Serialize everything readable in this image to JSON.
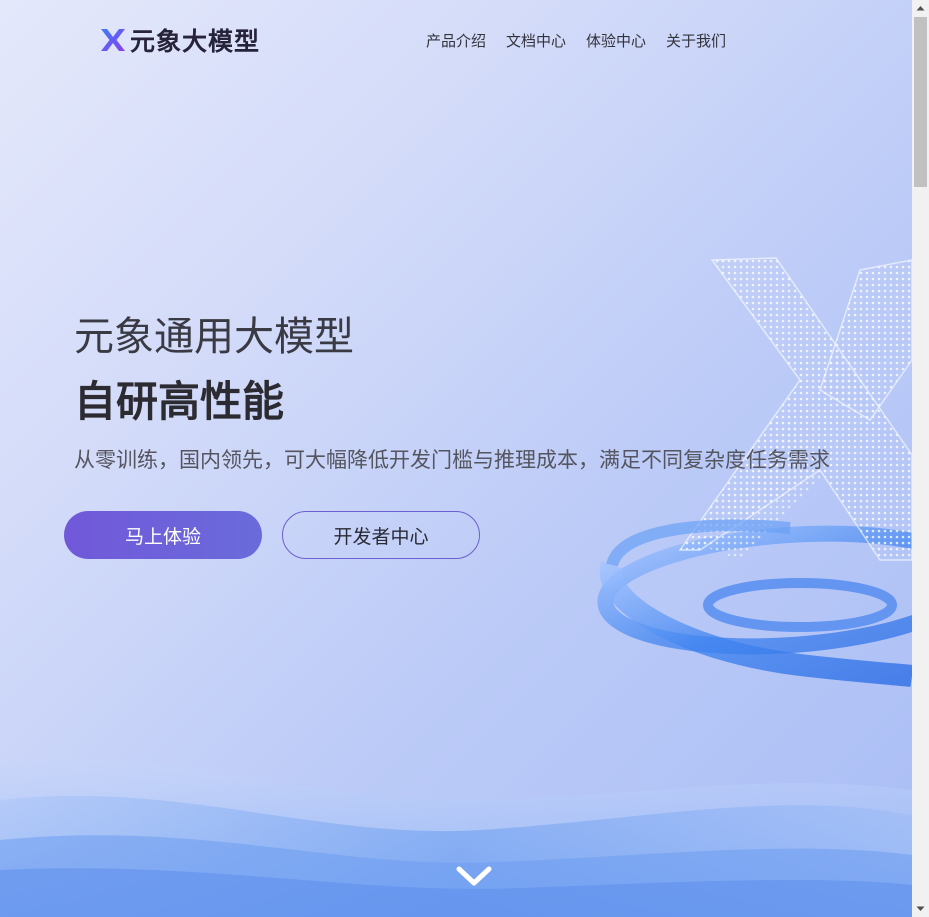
{
  "header": {
    "logo_text": "元象大模型",
    "nav": [
      "产品介绍",
      "文档中心",
      "体验中心",
      "关于我们"
    ]
  },
  "hero": {
    "title": "元象通用大模型",
    "subtitle": "自研高性能",
    "description": "从零训练，国内领先，可大幅降低开发门槛与推理成本，满足不同复杂度任务需求",
    "primary_button": "马上体验",
    "secondary_button": "开发者中心"
  },
  "icons": {
    "logo": "x-logo-icon",
    "scroll": "chevron-down-icon"
  },
  "colors": {
    "accent": "#6d5bd8",
    "logo_gradient": [
      "#3f7cf5",
      "#8a3ef0"
    ],
    "text": "#2b2b31"
  }
}
